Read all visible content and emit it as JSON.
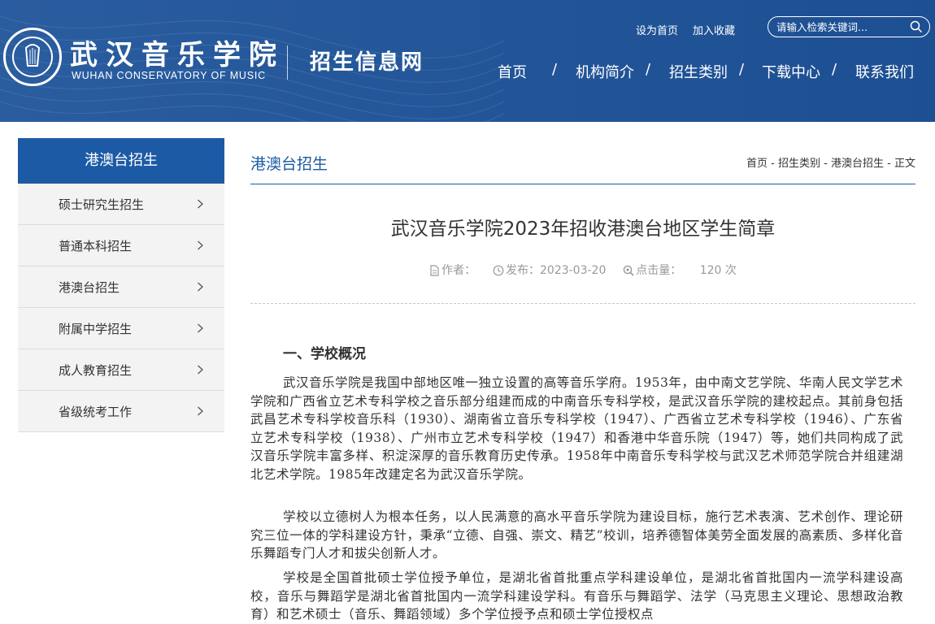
{
  "header": {
    "logo_cn": "武汉音乐学院",
    "logo_en": "WUHAN CONSERVATORY OF MUSIC",
    "site_name": "招生信息网",
    "set_home": "设为首页",
    "add_favorite": "加入收藏",
    "search_placeholder": "请输入检索关键词...",
    "nav": [
      "首页",
      "机构简介",
      "招生类别",
      "下载中心",
      "联系我们"
    ],
    "nav_separator": "/"
  },
  "sidebar": {
    "title": "港澳台招生",
    "items": [
      "硕士研究生招生",
      "普通本科招生",
      "港澳台招生",
      "附属中学招生",
      "成人教育招生",
      "省级统考工作"
    ]
  },
  "main": {
    "section_title": "港澳台招生",
    "breadcrumb": [
      "首页",
      "招生类别",
      "港澳台招生",
      "正文"
    ],
    "breadcrumb_separator": "-",
    "article_title": "武汉音乐学院2023年招收港澳台地区学生简章",
    "meta": {
      "author_label": "作者：",
      "publish_label": "发布：",
      "publish_date": "2023-03-20",
      "clicks_label": "点击量：",
      "clicks": "120 次"
    },
    "heading": "一、学校概况",
    "paragraphs": [
      "武汉音乐学院是我国中部地区唯一独立设置的高等音乐学府。1953年，由中南文艺学院、华南人民文学艺术学院和广西省立艺术专科学校之音乐部分组建而成的中南音乐专科学校，是武汉音乐学院的建校起点。其前身包括武昌艺术专科学校音乐科（1930）、湖南省立音乐专科学校（1947）、广西省立艺术专科学校（1946）、广东省立艺术专科学校（1938）、广州市立艺术专科学校（1947）和香港中华音乐院（1947）等，她们共同构成了武汉音乐学院丰富多样、积淀深厚的音乐教育历史传承。1958年中南音乐专科学校与武汉艺术师范学院合并组建湖北艺术学院。1985年改建定名为武汉音乐学院。",
      "学校以立德树人为根本任务，以人民满意的高水平音乐学院为建设目标，施行艺术表演、艺术创作、理论研究三位一体的学科建设方针，秉承“立德、自强、崇文、精艺”校训，培养德智体美劳全面发展的高素质、多样化音乐舞蹈专门人才和拔尖创新人才。",
      "学校是全国首批硕士学位授予单位，是湖北省首批重点学科建设单位，是湖北省首批国内一流学科建设高校，音乐与舞蹈学是湖北省首批国内一流学科建设学科。有音乐与舞蹈学、法学（马克思主义理论、思想政治教育）和艺术硕士（音乐、舞蹈领域）多个学位授予点和硕士学位授权点"
    ]
  }
}
